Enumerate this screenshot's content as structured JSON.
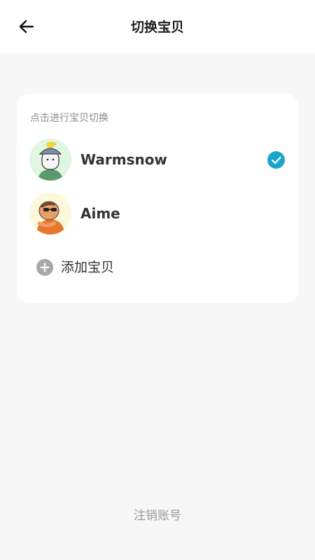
{
  "header": {
    "title": "切换宝贝",
    "back_icon": "arrow-left-icon"
  },
  "card": {
    "hint": "点击进行宝贝切换",
    "babies": [
      {
        "name": "Warmsnow",
        "selected": true,
        "avatar_icon": "kid-with-bird-avatar"
      },
      {
        "name": "Aime",
        "selected": false,
        "avatar_icon": "kid-with-sunglasses-avatar"
      }
    ],
    "add_label": "添加宝贝",
    "add_icon": "plus-circle-icon"
  },
  "footer": {
    "logout_label": "注销账号"
  },
  "colors": {
    "accent": "#1aa6c9",
    "add_icon_bg": "#a8a8a8",
    "page_bg": "#f7f7f7"
  }
}
